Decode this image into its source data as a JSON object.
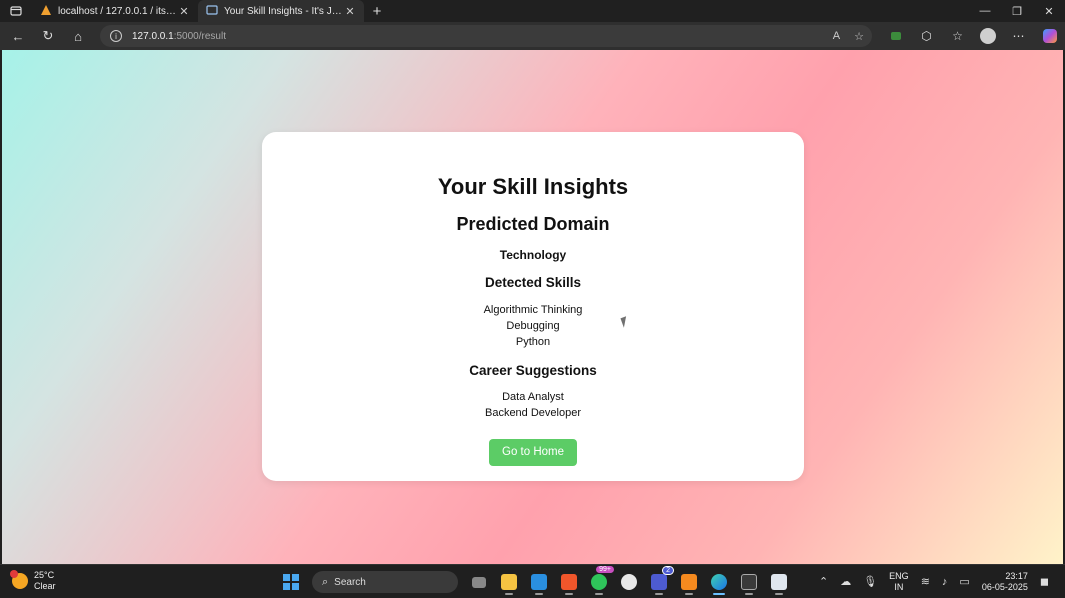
{
  "browser": {
    "tabs": [
      {
        "title": "localhost / 127.0.0.1 / its_just_you",
        "active": false,
        "icon": "phpmyadmin-icon"
      },
      {
        "title": "Your Skill Insights - It's Just You",
        "active": true,
        "icon": "page-icon"
      }
    ],
    "address": {
      "host": "127.0.0.1",
      "path": ":5000/result"
    }
  },
  "page": {
    "title": "Your Skill Insights",
    "domain_heading": "Predicted Domain",
    "domain_value": "Technology",
    "skills_heading": "Detected Skills",
    "skills": [
      "Algorithmic Thinking",
      "Debugging",
      "Python"
    ],
    "careers_heading": "Career Suggestions",
    "careers": [
      "Data Analyst",
      "Backend Developer"
    ],
    "home_button": "Go to Home"
  },
  "taskbar": {
    "weather_temp": "25°C",
    "weather_desc": "Clear",
    "search_label": "Search",
    "whatsapp_badge": "99+",
    "teams_badge": "2",
    "lang_top": "ENG",
    "lang_bottom": "IN",
    "time": "23:17",
    "date": "06-05-2025"
  },
  "colors": {
    "accent_button": "#5ccc66",
    "card_bg": "#ffffff"
  }
}
